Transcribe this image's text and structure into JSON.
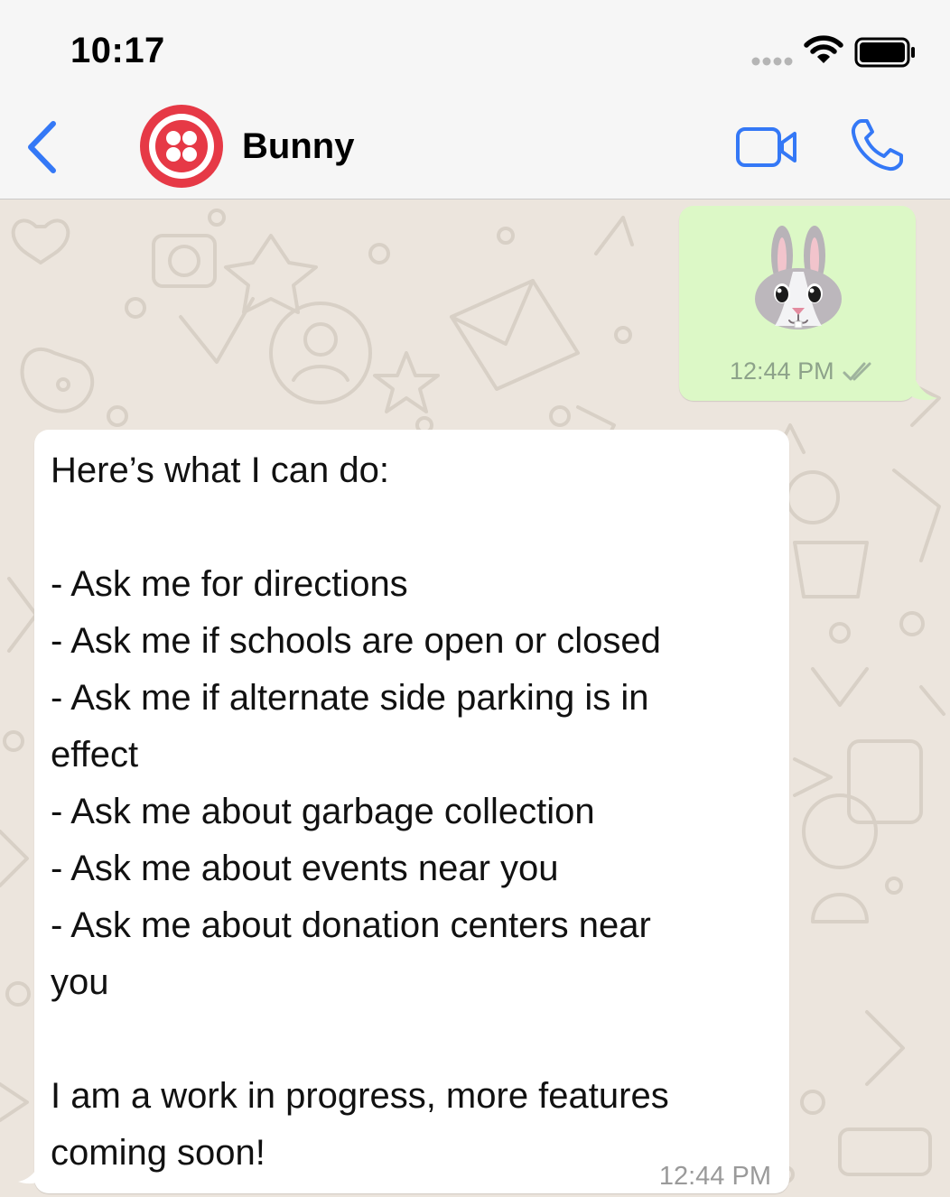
{
  "status_bar": {
    "time": "10:17"
  },
  "header": {
    "contact_name": "Bunny",
    "avatar_color": "#e63946"
  },
  "messages": [
    {
      "direction": "outgoing",
      "content": "bunny-emoji",
      "time": "12:44 PM",
      "status": "read-double-check",
      "bubble_color": "#dcf8c6"
    },
    {
      "direction": "incoming",
      "lines": [
        "Here’s what I can do:",
        "",
        "- Ask me for directions",
        "- Ask me if schools are open or closed",
        "- Ask me if alternate side parking is in",
        "effect",
        "- Ask me about garbage collection",
        "- Ask me about events near you",
        "- Ask me about donation centers near",
        "you",
        "",
        "I am a work in progress, more features",
        "coming soon!"
      ],
      "time": "12:44 PM",
      "bubble_color": "#ffffff"
    }
  ],
  "theme": {
    "accent": "#3478f6",
    "chat_background": "#ece5dd"
  }
}
